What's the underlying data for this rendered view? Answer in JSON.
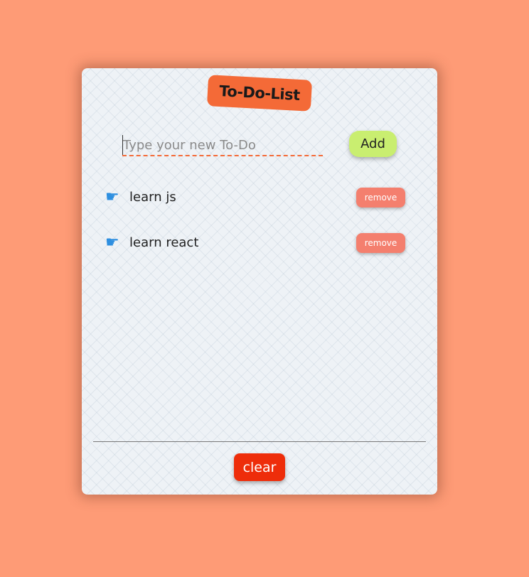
{
  "app": {
    "title": "To-Do-List"
  },
  "new_todo": {
    "value": "",
    "placeholder": "Type your new To-Do",
    "add_label": "Add"
  },
  "todos": [
    {
      "text": "learn js",
      "remove_label": "remove",
      "icon": "pointing-hand-icon"
    },
    {
      "text": "learn react",
      "remove_label": "remove",
      "icon": "pointing-hand-icon"
    }
  ],
  "footer": {
    "clear_label": "clear"
  },
  "colors": {
    "background": "#fe9b76",
    "title_badge": "#f46a37",
    "add_button": "#c9ee70",
    "remove_button": "#f47f6e",
    "clear_button": "#ee2d0a",
    "icon": "#2e8fe0"
  }
}
